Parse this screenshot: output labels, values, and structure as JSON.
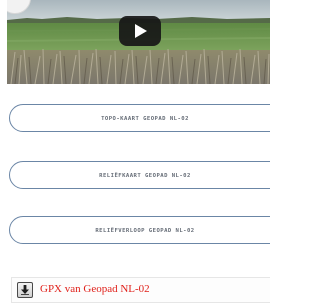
{
  "video": {
    "play_icon": "play-icon",
    "colors": {
      "sky": "#bcc7cc",
      "field": "#6f9a53",
      "foreground": "#8a8478",
      "play_bg": "#171717"
    }
  },
  "map_buttons": [
    {
      "label": "Topo-kaart Geopad NL-02"
    },
    {
      "label": "Reliëfkaart Geopad NL-02"
    },
    {
      "label": "Reliëfverloop Geopad NL-02"
    }
  ],
  "download": {
    "icon": "download-icon",
    "label": "GPX van Geopad NL-02",
    "link_color": "#e0201a"
  },
  "colors": {
    "button_border": "#6b86a6",
    "button_text": "#666d77"
  }
}
